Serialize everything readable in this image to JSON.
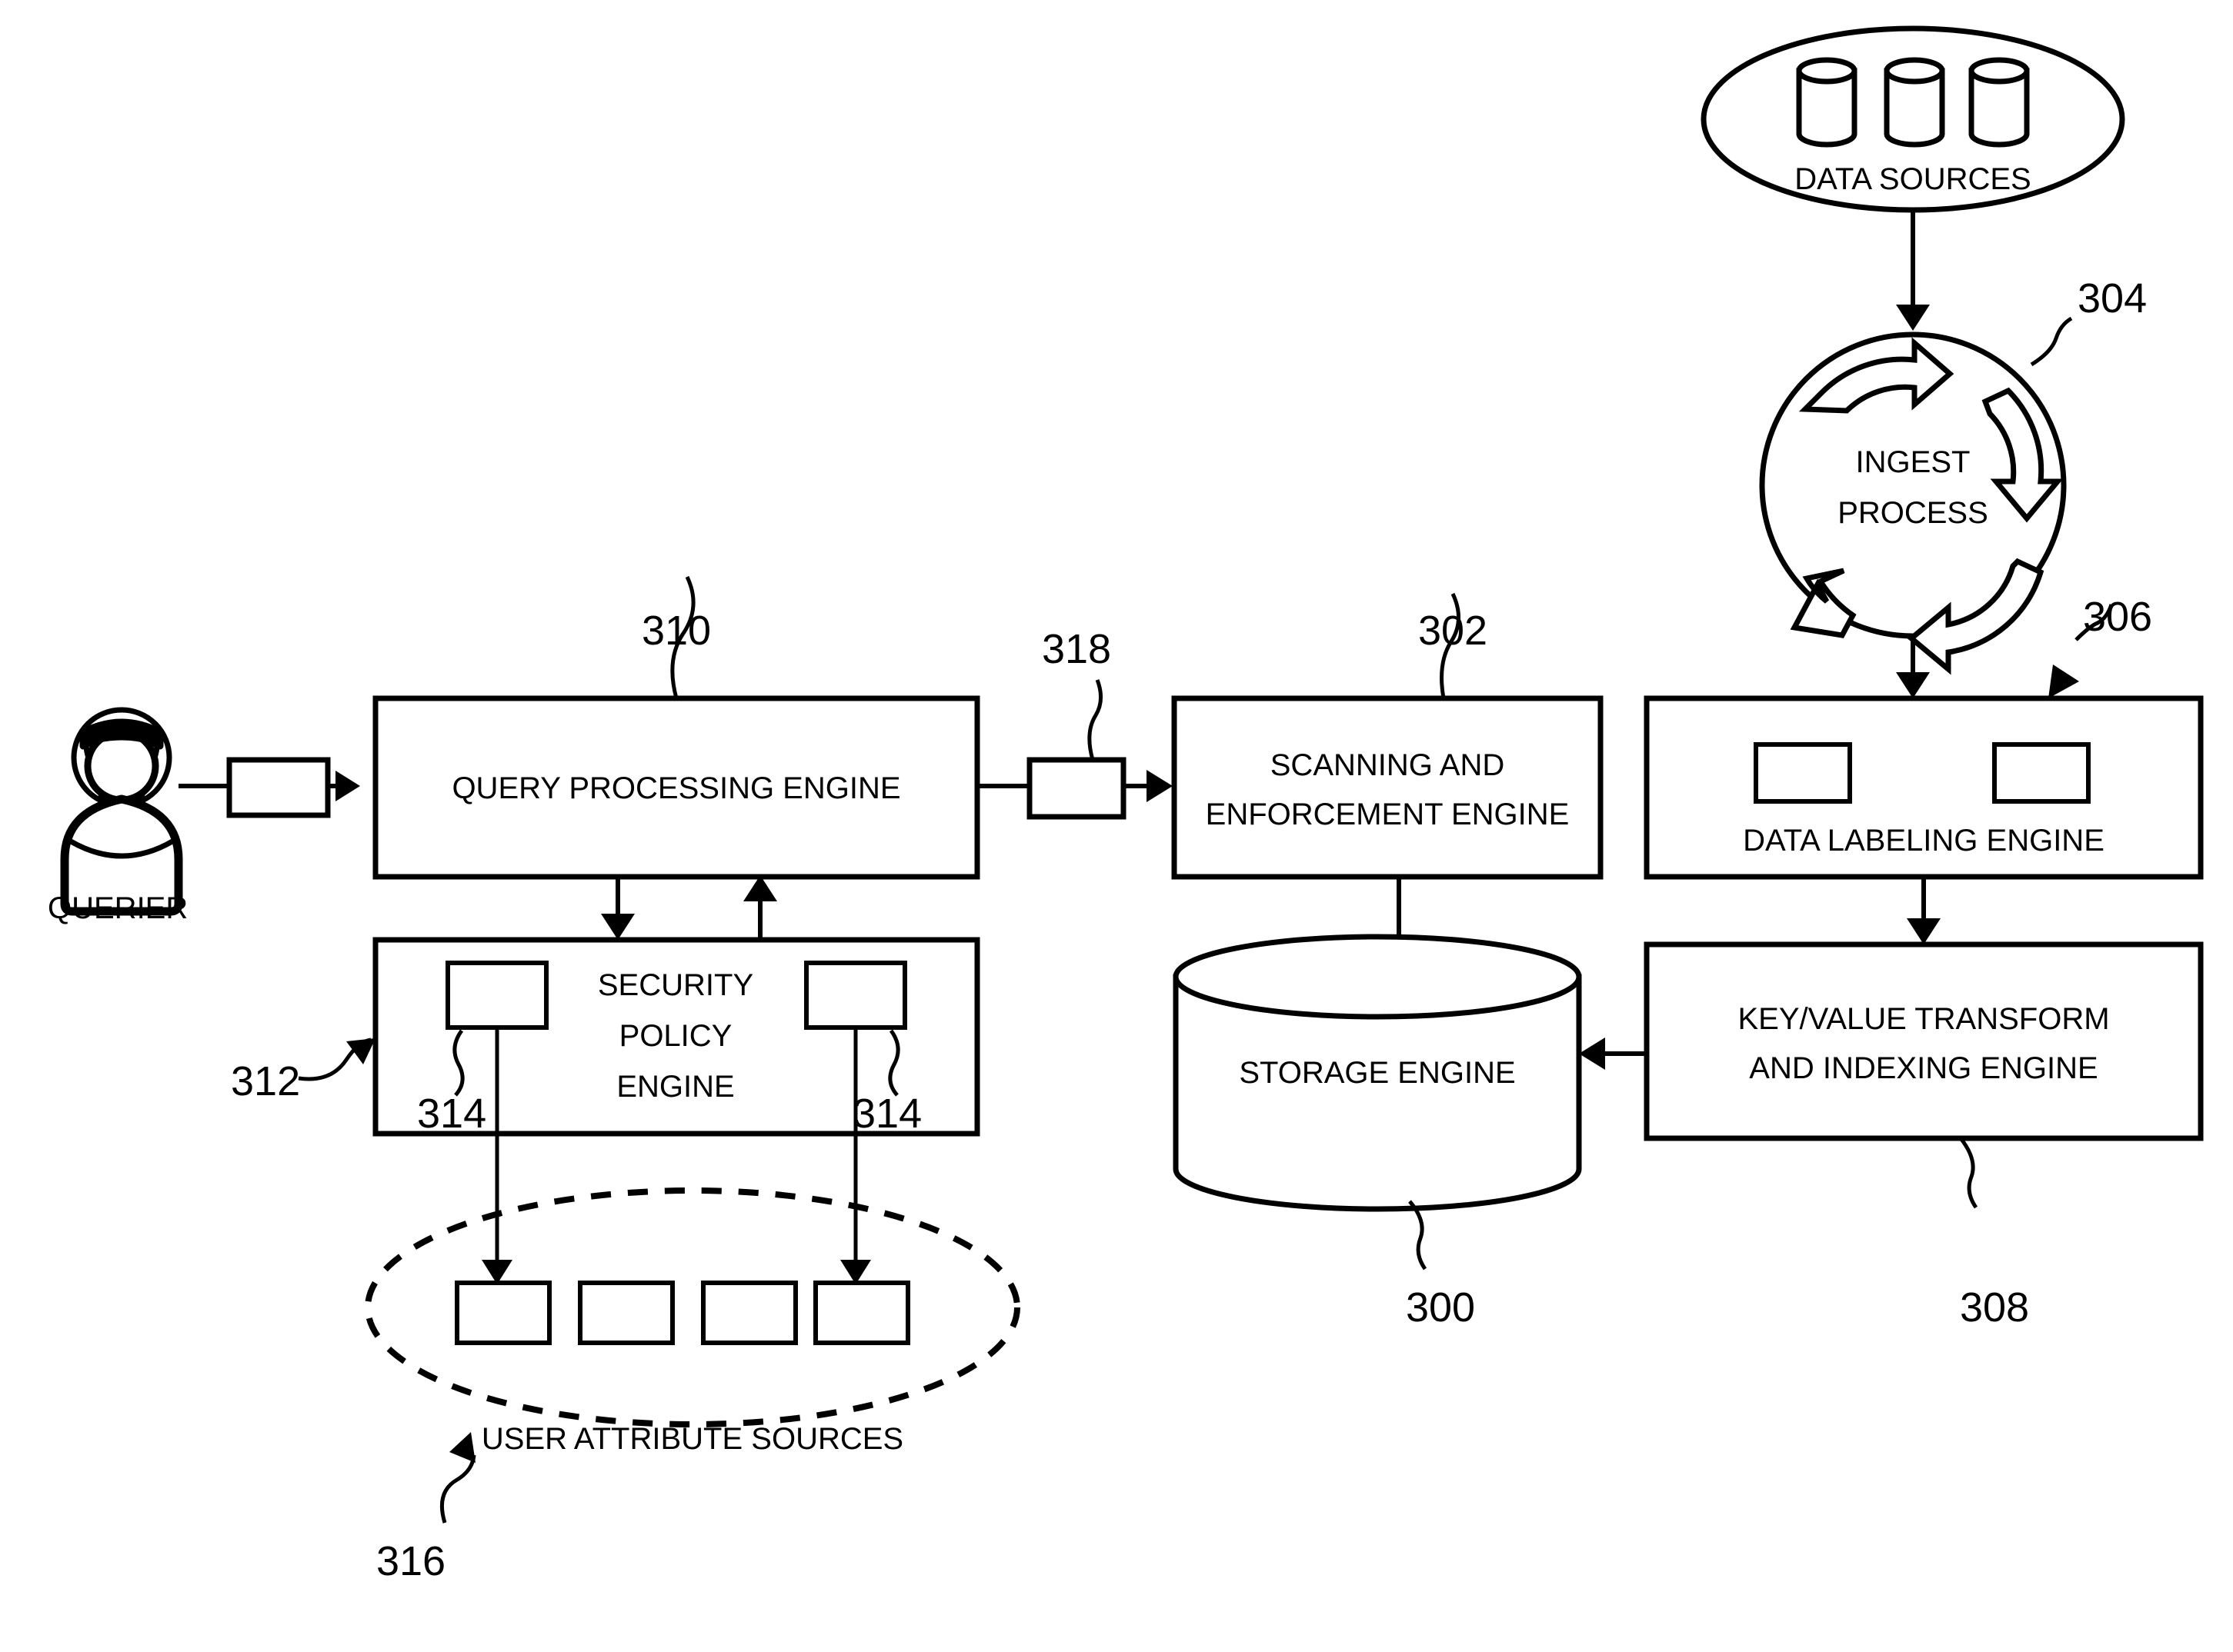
{
  "figure": {
    "type": "patent-block-diagram",
    "background_color": "#ffffff",
    "line_color": "#000000"
  },
  "nodes": {
    "querier": {
      "label": "QUERIER",
      "icon": "person-icon"
    },
    "query_processing_engine": {
      "label": "QUERY PROCESSING ENGINE",
      "ref": "310"
    },
    "security_policy_engine": {
      "label_line1": "SECURITY",
      "label_line2": "POLICY",
      "label_line3": "ENGINE",
      "ref": "312",
      "inner_ref_left": "314",
      "inner_ref_right": "314",
      "inner_box_count": 2
    },
    "user_attribute_sources": {
      "label": "USER ATTRIBUTE SOURCES",
      "ref": "316",
      "box_count": 4
    },
    "connector_318": {
      "ref": "318"
    },
    "connector_querier": {
      "ref": ""
    },
    "scanning_and_enforcement_engine": {
      "label_line1": "SCANNING AND",
      "label_line2": "ENFORCEMENT ENGINE",
      "ref": "302"
    },
    "storage_engine": {
      "label": "STORAGE ENGINE",
      "ref": "300"
    },
    "data_sources": {
      "label": "DATA SOURCES",
      "cylinder_count": 3
    },
    "ingest_process": {
      "label_line1": "INGEST",
      "label_line2": "PROCESS",
      "ref": "304"
    },
    "data_labeling_engine": {
      "label": "DATA LABELING ENGINE",
      "ref": "306",
      "inner_box_count": 2
    },
    "key_value_transform_engine": {
      "label_line1": "KEY/VALUE TRANSFORM",
      "label_line2": "AND INDEXING ENGINE",
      "ref": "308"
    }
  },
  "reference_numerals": [
    "300",
    "302",
    "304",
    "306",
    "308",
    "310",
    "312",
    "314",
    "314",
    "316",
    "318"
  ],
  "edges": [
    {
      "from": "querier",
      "to": "connector_querier",
      "style": "line"
    },
    {
      "from": "connector_querier",
      "to": "query_processing_engine",
      "style": "arrow"
    },
    {
      "from": "query_processing_engine",
      "to": "security_policy_engine",
      "style": "arrow-down"
    },
    {
      "from": "security_policy_engine",
      "to": "query_processing_engine",
      "style": "arrow-up"
    },
    {
      "from": "security_policy_engine",
      "to": "user_attribute_sources",
      "style": "arrow-down-2x"
    },
    {
      "from": "query_processing_engine",
      "to": "connector_318",
      "style": "line"
    },
    {
      "from": "connector_318",
      "to": "scanning_and_enforcement_engine",
      "style": "arrow"
    },
    {
      "from": "scanning_and_enforcement_engine",
      "to": "storage_engine",
      "style": "arrow-down"
    },
    {
      "from": "data_sources",
      "to": "ingest_process",
      "style": "arrow-down"
    },
    {
      "from": "ingest_process",
      "to": "data_labeling_engine",
      "style": "arrow-down"
    },
    {
      "from": "data_labeling_engine",
      "to": "key_value_transform_engine",
      "style": "arrow-down"
    },
    {
      "from": "key_value_transform_engine",
      "to": "storage_engine",
      "style": "arrow-left"
    }
  ]
}
